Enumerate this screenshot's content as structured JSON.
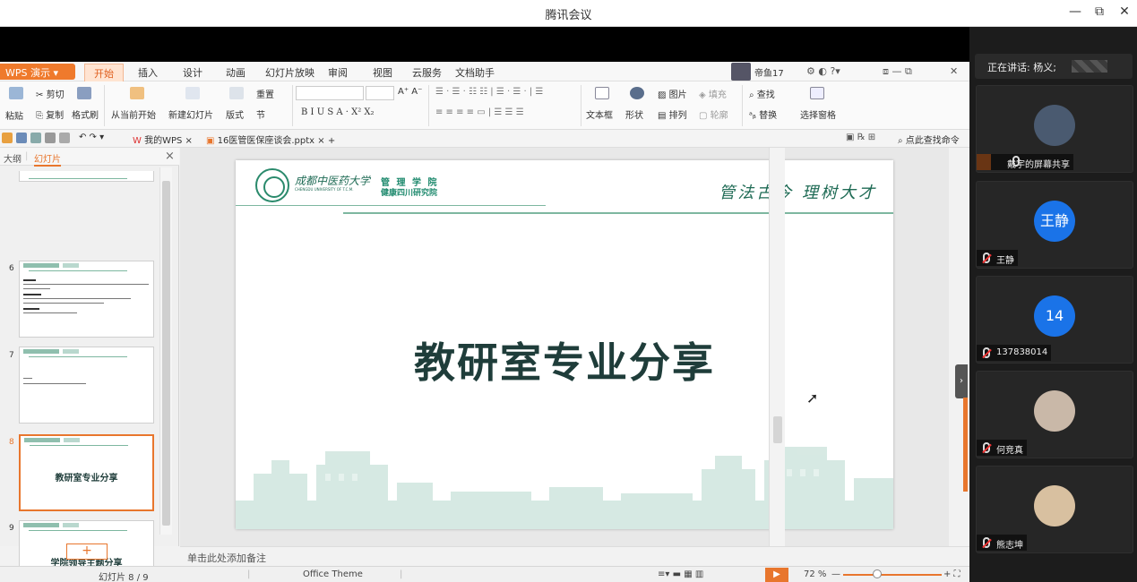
{
  "window": {
    "title": "腾讯会议",
    "controls": [
      "—",
      "⧉",
      "✕"
    ]
  },
  "wps": {
    "app_button": "WPS 演示",
    "menu_tabs": [
      "开始",
      "插入",
      "设计",
      "动画",
      "幻灯片放映",
      "审阅",
      "视图",
      "云服务",
      "文档助手"
    ],
    "user": "帝鱼17",
    "ribbon": {
      "paste": "粘贴",
      "cut": "剪切",
      "copy": "复制",
      "format_painter": "格式刷",
      "from_current": "从当前开始",
      "new_slide": "新建幻灯片",
      "layout": "版式",
      "section": "节",
      "reset": "重置",
      "font_bold": "B",
      "font_italic": "I",
      "font_underline": "U",
      "font_s": "S",
      "font_a": "A",
      "textbox": "文本框",
      "shape": "形状",
      "picture": "图片",
      "fill": "填充",
      "arrange": "排列",
      "outline": "轮廓",
      "find": "查找",
      "replace": "替换",
      "select_pane": "选择窗格"
    },
    "doc_tabs": [
      "我的WPS",
      "16医管医保座谈会.pptx"
    ],
    "search_cmd": "点此查找命令",
    "panel": {
      "outline_tab": "大纲",
      "slides_tab": "幻灯片"
    },
    "thumbs": [
      {
        "num": "6",
        "title": ""
      },
      {
        "num": "7",
        "title": ""
      },
      {
        "num": "8",
        "title": "教研室专业分享"
      },
      {
        "num": "9",
        "title": "学院领导主题分享"
      }
    ],
    "slide": {
      "logo_cn": "成都中医药大学",
      "logo_en": "CHENGDU UNIVERSITY OF T.C.M.",
      "dept": "管 理 学 院",
      "institute": "健康四川研究院",
      "motto": "管法古今 理树大才",
      "title": "教研室专业分享"
    },
    "notes_placeholder": "单击此处添加备注",
    "status": {
      "slide_count": "幻灯片 8 / 9",
      "theme": "Office Theme",
      "zoom": "72 %"
    }
  },
  "meeting": {
    "speaking": "正在讲话: 杨义;",
    "participants": [
      {
        "name": "戴宇的屏幕共享",
        "initial": "",
        "color": "#4a5a70",
        "muted": false,
        "sharing": true
      },
      {
        "name": "王静",
        "initial": "王静",
        "color": "#1a73e8",
        "muted": true,
        "sharing": false
      },
      {
        "name": "137838014",
        "initial": "14",
        "color": "#1a73e8",
        "muted": true,
        "sharing": false
      },
      {
        "name": "何竞真",
        "initial": "",
        "color": "#c9b8a8",
        "muted": true,
        "sharing": false
      },
      {
        "name": "熊志坤",
        "initial": "",
        "color": "#d8c0a0",
        "muted": true,
        "sharing": false
      }
    ]
  }
}
